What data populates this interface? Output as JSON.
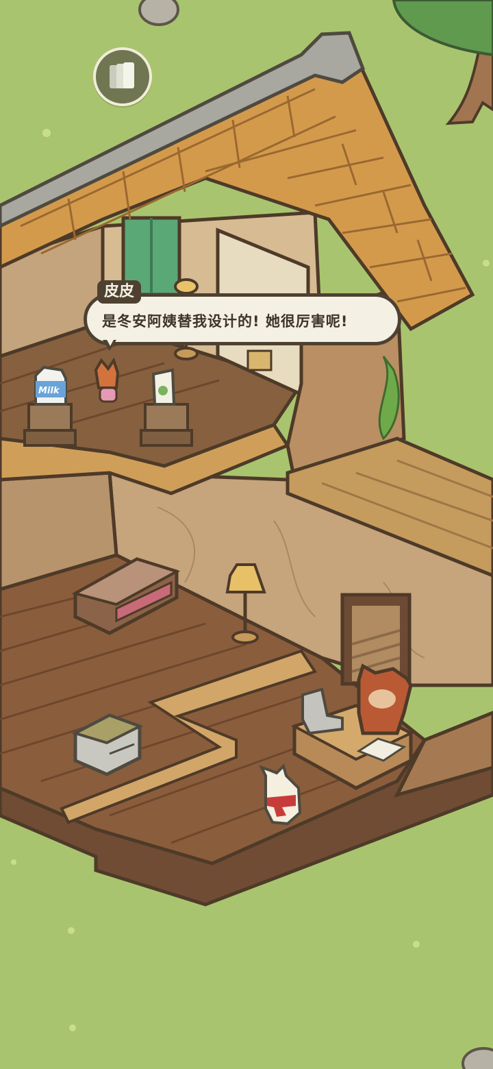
{
  "dialog": {
    "speaker": "皮皮",
    "text": "是冬安阿姨替我设计的! 她很厉害呢!"
  },
  "items": {
    "milk_label": "Milk"
  },
  "icons": {
    "menu_button": "cards-icon"
  },
  "colors": {
    "grass": "#a9c46f",
    "roof": "#d49a4c",
    "wood_floor": "#8a5d3c",
    "wall": "#c8a77f",
    "outline": "#4e4131",
    "bubble": "#f4f0e3"
  }
}
